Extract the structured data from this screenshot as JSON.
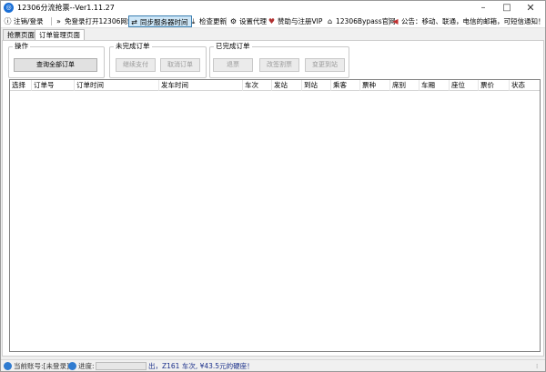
{
  "window": {
    "title": "12306分流抢票--Ver1.11.27",
    "controls": {
      "minimize": "–",
      "maximize": "□",
      "close": "✕"
    }
  },
  "toolbar": {
    "items": [
      {
        "icon": "info-circle-icon",
        "glyph": "ⓘ",
        "label": "注销/登录"
      },
      {
        "icon": "double-chevron-icon",
        "glyph": "»",
        "label": "免登录打开12306网站"
      },
      {
        "icon": "sync-icon",
        "glyph": "⇄",
        "label": "同步服务器时间"
      },
      {
        "icon": "download-icon",
        "glyph": "⤓",
        "label": "检查更新"
      },
      {
        "icon": "gear-icon",
        "glyph": "⚙",
        "label": "设置代理"
      },
      {
        "icon": "heart-icon",
        "glyph": "♥",
        "label": "赞助与注册VIP"
      },
      {
        "icon": "home-icon",
        "glyph": "⌂",
        "label": "12306Bypass官网"
      },
      {
        "icon": "megaphone-icon",
        "glyph": "◀",
        "label": "公告：移动、联通，电信的邮箱，可短信通知！"
      }
    ]
  },
  "tabs": [
    {
      "label": "抢票页面"
    },
    {
      "label": "订单管理页面"
    }
  ],
  "groups": {
    "operation": {
      "title": "操作",
      "query_all": "查询全部订单"
    },
    "unfinished": {
      "title": "未完成订单",
      "continue_pay": "继续支付",
      "cancel_order": "取消订单"
    },
    "finished": {
      "title": "已完成订单",
      "refund": "退票",
      "change_ticket": "改签割票",
      "change_station": "变更到站"
    }
  },
  "grid": {
    "columns": [
      "选择",
      "订单号",
      "订单时间",
      "发车时间",
      "车次",
      "发站",
      "到站",
      "乘客",
      "票种",
      "席别",
      "车厢",
      "座位",
      "票价",
      "状态"
    ],
    "rows": []
  },
  "statusbar": {
    "account": "当前账号:[未登录]",
    "progress_label": "进度:",
    "progress_value": 0,
    "message": "出，Z161 车次, ¥43.5元的硬座！",
    "grip": "⁞"
  }
}
